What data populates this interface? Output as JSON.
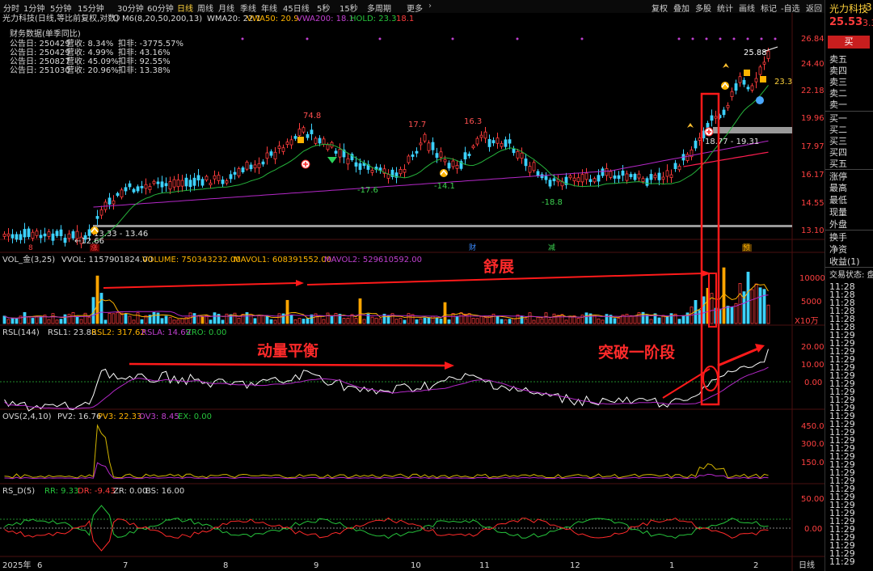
{
  "toolbar": {
    "timeframes": [
      "分时",
      "1分钟",
      "5分钟",
      "15分钟",
      "30分钟",
      "60分钟",
      "日线",
      "周线",
      "月线",
      "季线",
      "年线",
      "45日线",
      "5秒",
      "15秒",
      "多周期",
      "更多"
    ],
    "active_timeframe": "日线",
    "right_tools": [
      "复权",
      "叠加",
      "多股",
      "统计",
      "画线",
      "标记",
      "-自选",
      "返回"
    ]
  },
  "main_panel": {
    "stock_title": "光力科技(日线,等比前复权,对数)",
    "indicator_name": "M6(8,20,50,200,13)",
    "wma20": "WMA20: 22.1",
    "vwa50": "VWA50: 20.9",
    "vwa200": "VWA200: 18.1",
    "hold": "HOLD: 23.3",
    "hold_extra": "18.1",
    "finance_title": "财务数据(单季同比)",
    "finance_rows": [
      {
        "date": "公告日: 250429",
        "rev": "营收:  8.34%",
        "np": "扣非: -3775.57%"
      },
      {
        "date": "公告日: 250429",
        "rev": "营收:  4.99%",
        "np": "扣非:  43.16%"
      },
      {
        "date": "公告日: 250827",
        "rev": "营收: 45.09%",
        "np": "扣非:  92.55%"
      },
      {
        "date": "公告日: 251030",
        "rev": "营收: 20.96%",
        "np": "扣非:  13.38%"
      }
    ],
    "y_ticks": [
      "26.84",
      "24.40",
      "22.18",
      "19.96",
      "17.97",
      "16.17",
      "14.55",
      "13.10"
    ],
    "annotations": {
      "high": "25.88",
      "last": "23.3",
      "range_right": "18.77 - 19.31",
      "range_left": "13.33 - 13.46",
      "low_left": "←12.66",
      "peak1": "74.8",
      "peak2": "17.7",
      "peak3": "16.3",
      "trough1": "-17.6",
      "trough2": "-14.1",
      "trough3": "-18.8"
    },
    "markers": {
      "m1": "8",
      "m2": "涨",
      "m3": "财",
      "m4": "减",
      "m5": "预"
    }
  },
  "vol_panel": {
    "name": "VOL_金(3,25)",
    "vvol": "VVOL: 1157901824.00",
    "volume": "VOLUME: 750343232.00",
    "mavol1": "MAVOL1: 608391552.00",
    "mavol2": "MAVOL2: 529610592.00",
    "ticks": [
      "10000",
      "5000",
      "X10万"
    ],
    "annotation": "舒展"
  },
  "rsl_panel": {
    "name": "RSL(144)",
    "rsl1": "RSL1: 23.88",
    "rsl2": "RSL2: 317.62",
    "rsla": "RSLA: 14.69",
    "zro": "ZRO: 0.00",
    "ticks": [
      "20.00",
      "10.00",
      "0.00"
    ],
    "annotation_left": "动量平衡",
    "annotation_right": "突破一阶段"
  },
  "ovs_panel": {
    "name": "OVS(2,4,10)",
    "pv2": "PV2: 16.76",
    "pv3": "PV3: 22.33",
    "ov3": "OV3: 8.45",
    "ex": "EX: 0.00",
    "ticks": [
      "450.0",
      "300.0",
      "150.0"
    ]
  },
  "rsd_panel": {
    "name": "RS_D(5)",
    "rr": "RR: 9.33",
    "dr": "DR: -9.43",
    "zr": "ZR: 0.00",
    "bs": "BS: 16.00",
    "ticks": [
      "50.00",
      "0.00"
    ]
  },
  "x_axis": {
    "year": "2025年",
    "months": [
      "6",
      "7",
      "8",
      "9",
      "10",
      "11",
      "12",
      "1",
      "2"
    ],
    "period": "日线"
  },
  "right_panel": {
    "stock_name": "光力科技",
    "code_partial": "3",
    "price": "25.53",
    "change": "3.3",
    "buy_button": "买",
    "sells": [
      "卖五",
      "卖四",
      "卖三",
      "卖二",
      "卖一"
    ],
    "buys": [
      "买一",
      "买二",
      "买三",
      "买四",
      "买五"
    ],
    "stats": [
      "涨停",
      "最高",
      "最低",
      "现量",
      "外盘"
    ],
    "stats2": [
      "换手",
      "净资",
      "收益(1)"
    ],
    "trade_status": "交易状态: 盘",
    "times": [
      "11:28",
      "11:28",
      "11:28",
      "11:28",
      "11:28",
      "11:28",
      "11:29",
      "11:29",
      "11:29",
      "11:29",
      "11:29",
      "11:29",
      "11:29",
      "11:29",
      "11:29",
      "11:29",
      "11:29",
      "11:29",
      "11:29",
      "11:29",
      "11:29",
      "11:29",
      "11:29",
      "11:29",
      "11:29",
      "11:29",
      "11:29",
      "11:29",
      "11:29",
      "11:29",
      "11:29",
      "11:29",
      "11:29",
      "11:29",
      "11:29"
    ]
  },
  "colors": {
    "up": "#ff3c3c",
    "down": "#3cd2ff",
    "wma": "#ff1e50",
    "vwa50": "#26b43c",
    "vwa200": "#b428c8",
    "gold": "#ffb400",
    "highlight": "#ff1a1a"
  }
}
